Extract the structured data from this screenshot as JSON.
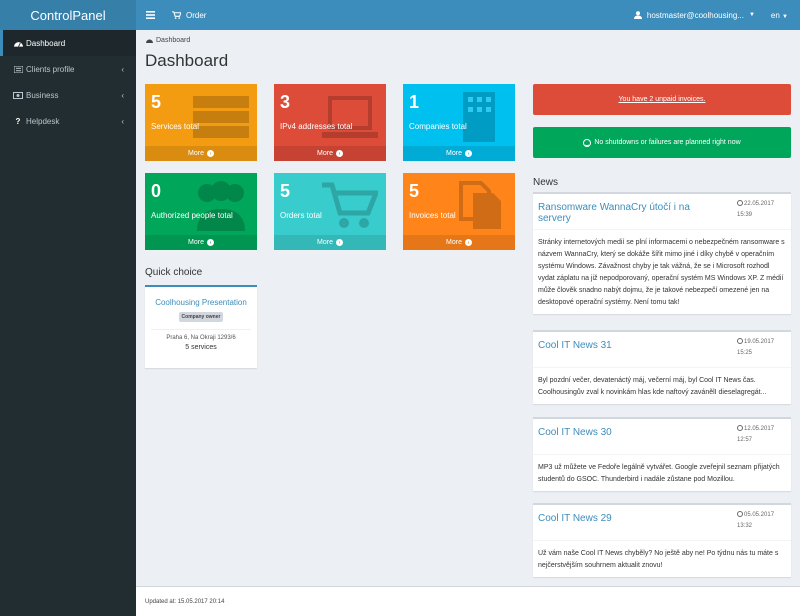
{
  "app": {
    "title": "ControlPanel"
  },
  "topbar": {
    "order_label": "Order",
    "user_label": "hostmaster@coolhousing...",
    "lang_label": "en"
  },
  "sidebar": {
    "items": [
      {
        "label": "Dashboard",
        "icon": "dashboard-icon",
        "active": true
      },
      {
        "label": "Clients profile",
        "icon": "list-icon"
      },
      {
        "label": "Business",
        "icon": "money-icon"
      },
      {
        "label": "Helpdesk",
        "icon": "question-icon"
      }
    ]
  },
  "breadcrumb": {
    "label": "Dashboard"
  },
  "page": {
    "title": "Dashboard"
  },
  "stats": [
    {
      "value": "5",
      "label": "Services total",
      "more": "More",
      "color": "#f39c12",
      "icon": "server-icon"
    },
    {
      "value": "3",
      "label": "IPv4 addresses total",
      "more": "More",
      "color": "#dd4b39",
      "icon": "laptop-icon"
    },
    {
      "value": "1",
      "label": "Companies total",
      "more": "More",
      "color": "#00c0ef",
      "icon": "building-icon"
    },
    {
      "value": "0",
      "label": "Authorized people total",
      "more": "More",
      "color": "#00a65a",
      "icon": "users-icon"
    },
    {
      "value": "5",
      "label": "Orders total",
      "more": "More",
      "color": "#39cccc",
      "icon": "cart-icon"
    },
    {
      "value": "5",
      "label": "Invoices total",
      "more": "More",
      "color": "#ff851b",
      "icon": "files-icon"
    }
  ],
  "quick_choice": {
    "title": "Quick choice",
    "card": {
      "name": "Coolhousing Presentation",
      "badge": "Company owner",
      "address": "Praha 6, Na Okraji 1293/6",
      "services": "5 services"
    }
  },
  "alerts": {
    "unpaid": "You have 2 unpaid invoices.",
    "shutdowns": "No shutdowns or failures are planned right now"
  },
  "news": {
    "title": "News",
    "items": [
      {
        "title": "Ransomware WannaCry útočí i na servery",
        "date": "22.05.2017",
        "time": "15:39",
        "body": "Stránky internetových medií se plní informacemi o nebezpečném ransomware s názvem WannaCry, který se dokáže šířit mimo jiné i díky chybě v operačním systému Windows. Závažnost chyby je tak vážná, že se i Microsoft rozhodl vydat záplatu na již nepodporovaný, operační systém MS Windows XP. Z médií může člověk snadno nabýt dojmu, že je takové nebezpečí omezené jen na desktopové operační systémy. Není tomu tak!"
      },
      {
        "title": "Cool IT News 31",
        "date": "19.05.2017",
        "time": "15:25",
        "body": "Byl pozdní večer, devatenáctý máj, večerní máj, byl Cool IT News čas. Coolhousingův zval k novinkám hlas kde naftový zavánělI dieselagregát..."
      },
      {
        "title": "Cool IT News 30",
        "date": "12.05.2017",
        "time": "12:57",
        "body": "MP3 už můžete ve Fedoře legálně vytvářet. Google zveřejnil seznam přijatých studentů do GSOC. Thunderbird i nadále zůstane pod Mozillou."
      },
      {
        "title": "Cool IT News 29",
        "date": "05.05.2017",
        "time": "13:32",
        "body": "Už vám naše Cool IT News chyběly? No ještě aby ne! Po týdnu nás tu máte s nejčerstvějším souhrnem aktualit znovu!"
      }
    ]
  },
  "footer": {
    "updated": "Updated at: 15.05.2017 20:14"
  }
}
